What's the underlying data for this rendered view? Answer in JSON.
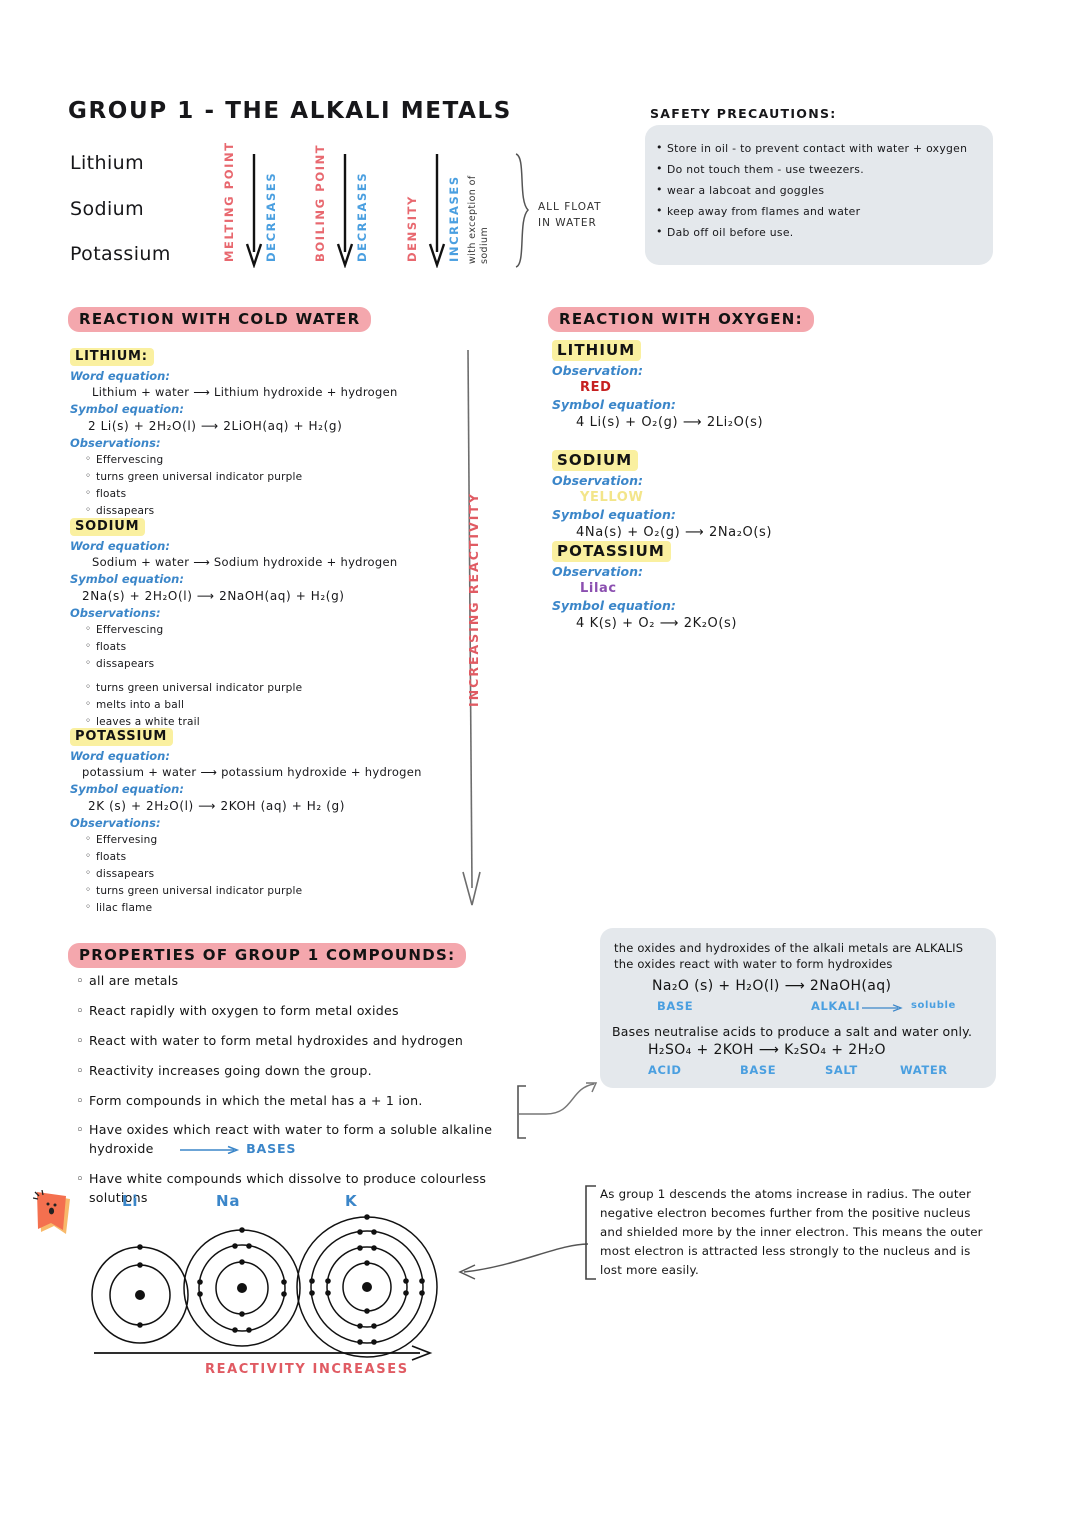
{
  "title": "GROUP 1 - THE ALKALI METALS",
  "elements": [
    "Lithium",
    "Sodium",
    "Potassium"
  ],
  "trends": [
    {
      "property": "MELTING POINT",
      "direction": "DECREASES",
      "note": ""
    },
    {
      "property": "BOILING POINT",
      "direction": "DECREASES",
      "note": ""
    },
    {
      "property": "DENSITY",
      "direction": "INCREASES",
      "note": "with exception of sodium"
    }
  ],
  "float_note": "ALL FLOAT\nIN WATER",
  "float_note_line1": "ALL FLOAT",
  "float_note_line2": "IN WATER",
  "safety": {
    "title": "SAFETY PRECAUTIONS:",
    "items": [
      "Store in oil - to prevent contact with water + oxygen",
      "Do not touch them - use tweezers.",
      "wear a labcoat and goggles",
      "keep away from flames and water",
      "Dab off oil before use."
    ]
  },
  "water_section": {
    "header": "REACTION WITH COLD WATER",
    "labels": {
      "word": "Word equation:",
      "symbol": "Symbol equation:",
      "observations": "Observations:"
    },
    "metals": [
      {
        "name": "LITHIUM:",
        "word_equation": "Lithium + water ⟶ Lithium hydroxide + hydrogen",
        "symbol_equation": "2 Li(s)   +   2H₂O(l)  ⟶   2LiOH(aq)    +    H₂(g)",
        "observations": [
          "Effervescing",
          "turns green universal indicator purple",
          "floats",
          "dissapears"
        ]
      },
      {
        "name": "SODIUM",
        "word_equation": "Sodium + water ⟶ Sodium hydroxide + hydrogen",
        "symbol_equation": "2Na(s) + 2H₂O(l) ⟶ 2NaOH(aq)  +  H₂(g)",
        "observations": [
          "Effervescing",
          "floats",
          "dissapears",
          "turns green universal indicator purple",
          "melts into a ball",
          "leaves a white trail"
        ]
      },
      {
        "name": "POTASSIUM",
        "word_equation": "potassium + water ⟶ potassium hydroxide + hydrogen",
        "symbol_equation": "2K (s)   +   2H₂O(l)  ⟶   2KOH (aq)     +    H₂ (g)",
        "observations": [
          "Effervesing",
          "floats",
          "dissapears",
          "turns green universal indicator purple",
          "lilac flame"
        ]
      }
    ]
  },
  "reactivity_arrow_label": "INCREASING REACTIVITY",
  "oxygen_section": {
    "header": "REACTION WITH OXYGEN:",
    "labels": {
      "observation": "Observation:",
      "symbol": "Symbol equation:"
    },
    "metals": [
      {
        "name": "LITHIUM",
        "observation": "RED",
        "observation_color": "#c62020",
        "symbol_equation": "4 Li(s)   +    O₂(g)   ⟶   2Li₂O(s)"
      },
      {
        "name": "SODIUM",
        "observation": "YELLOW",
        "observation_color": "#f3e58a",
        "symbol_equation": "4Na(s)  +   O₂(g)  ⟶  2Na₂O(s)"
      },
      {
        "name": "POTASSIUM",
        "observation": "Lilac",
        "observation_color": "#8b4fb0",
        "symbol_equation": "4 K(s) +   O₂   ⟶    2K₂O(s)"
      }
    ]
  },
  "properties_section": {
    "header": "PROPERTIES OF GROUP 1 COMPOUNDS:",
    "items": [
      "all are metals",
      "React rapidly with oxygen to form metal oxides",
      "React with water to form metal hydroxides and hydrogen",
      "Reactivity increases going down the group.",
      "Form compounds in which the metal has a  + 1  ion.",
      "Have oxides which react with water to form a soluble alkaline hydroxide",
      "Have white compounds which dissolve to produce colourless solutions"
    ],
    "bases_arrow_label": "BASES"
  },
  "alkalis_box": {
    "line1": "the oxides and hydroxides of the alkali metals are ALKALIS",
    "line2": "the oxides react with water to form hydroxides",
    "equation1": "Na₂O (s)  +   H₂O(l)  ⟶  2NaOH(aq)",
    "equation1_tags": [
      "BASE",
      "ALKALI",
      "soluble"
    ],
    "line3": "Bases neutralise acids to produce a salt and water only.",
    "equation2": "H₂SO₄    +   2KOH  ⟶  K₂SO₄  +  2H₂O",
    "equation2_tags": [
      "ACID",
      "BASE",
      "SALT",
      "WATER"
    ]
  },
  "atoms": {
    "labels": [
      "Li",
      "Na",
      "K"
    ],
    "shells": [
      [
        2,
        1
      ],
      [
        2,
        8,
        1
      ],
      [
        2,
        8,
        8,
        1
      ]
    ],
    "arrow_label": "REACTIVITY INCREASES"
  },
  "radius_note": "As group 1 descends the atoms increase in radius. The outer negative electron becomes further from the positive nucleus and shielded more by the inner electron. This means the outer most electron is attracted less strongly to the nucleus and is lost more easily.",
  "colors": {
    "pink_highlight": "#f4a7ad",
    "yellow_highlight": "#faf0a0",
    "blue_ink": "#3b86c9",
    "red_ink": "#e05b63",
    "box_grey": "#e4e8ec"
  }
}
